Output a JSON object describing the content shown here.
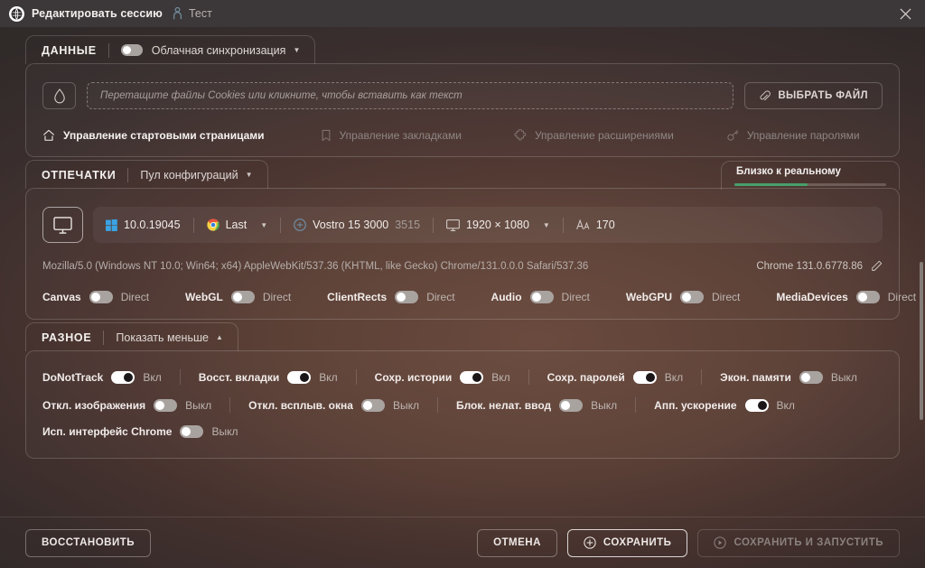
{
  "window": {
    "title": "Редактировать сессию",
    "session_name": "Тест",
    "close_label": "✕"
  },
  "data_section": {
    "title": "ДАННЫЕ",
    "cloud_sync_label": "Облачная синхронизация",
    "cloud_sync_state": "off",
    "dropzone_placeholder": "Перетащите файлы Cookies или кликните, чтобы вставить как текст",
    "select_file_label": "ВЫБРАТЬ ФАЙЛ",
    "manage_links": [
      {
        "label": "Управление стартовыми страницами",
        "icon": "home-icon",
        "active": true
      },
      {
        "label": "Управление закладками",
        "icon": "bookmark-icon",
        "active": false
      },
      {
        "label": "Управление расширениями",
        "icon": "puzzle-icon",
        "active": false
      },
      {
        "label": "Управление паролями",
        "icon": "key-icon",
        "active": false
      }
    ]
  },
  "fingerprints_section": {
    "title": "ОТПЕЧАТКИ",
    "config_pool_label": "Пул конфигураций",
    "realism_label": "Близко к реальному",
    "realism_percent": 48,
    "realism_color": "#46a06a",
    "device_icon": "desktop-icon",
    "os_version": "10.0.19045",
    "browser_channel": "Last",
    "device_model_main": "Vostro 15 3000",
    "device_model_sub": "3515",
    "resolution": "1920 × 1080",
    "fonts_count": "170",
    "user_agent": "Mozilla/5.0 (Windows NT 10.0; Win64; x64) AppleWebKit/537.36 (KHTML, like Gecko) Chrome/131.0.0.0 Safari/537.36",
    "browser_version": "Chrome 131.0.6778.86",
    "edit_icon": "pencil-icon",
    "toggles": [
      {
        "label": "Canvas",
        "state": "Direct",
        "on": false
      },
      {
        "label": "WebGL",
        "state": "Direct",
        "on": false
      },
      {
        "label": "ClientRects",
        "state": "Direct",
        "on": false
      },
      {
        "label": "Audio",
        "state": "Direct",
        "on": false
      },
      {
        "label": "WebGPU",
        "state": "Direct",
        "on": false
      },
      {
        "label": "MediaDevices",
        "state": "Direct",
        "on": false
      }
    ]
  },
  "misc_section": {
    "title": "РАЗНОЕ",
    "show_less_label": "Показать меньше",
    "rows": [
      [
        {
          "label": "DoNotTrack",
          "state": "Вкл",
          "on": true
        },
        {
          "label": "Восст. вкладки",
          "state": "Вкл",
          "on": true
        },
        {
          "label": "Сохр. истории",
          "state": "Вкл",
          "on": true
        },
        {
          "label": "Сохр. паролей",
          "state": "Вкл",
          "on": true
        },
        {
          "label": "Экон. памяти",
          "state": "Выкл",
          "on": false
        }
      ],
      [
        {
          "label": "Откл. изображения",
          "state": "Выкл",
          "on": false
        },
        {
          "label": "Откл. всплыв. окна",
          "state": "Выкл",
          "on": false
        },
        {
          "label": "Блок. нелат. ввод",
          "state": "Выкл",
          "on": false
        },
        {
          "label": "Апп. ускорение",
          "state": "Вкл",
          "on": true
        }
      ],
      [
        {
          "label": "Исп. интерфейс Chrome",
          "state": "Выкл",
          "on": false
        }
      ]
    ]
  },
  "footer": {
    "restore_label": "ВОССТАНОВИТЬ",
    "cancel_label": "ОТМЕНА",
    "save_label": "СОХРАНИТЬ",
    "save_and_run_label": "СОХРАНИТЬ И ЗАПУСТИТЬ",
    "save_and_run_disabled": true
  }
}
